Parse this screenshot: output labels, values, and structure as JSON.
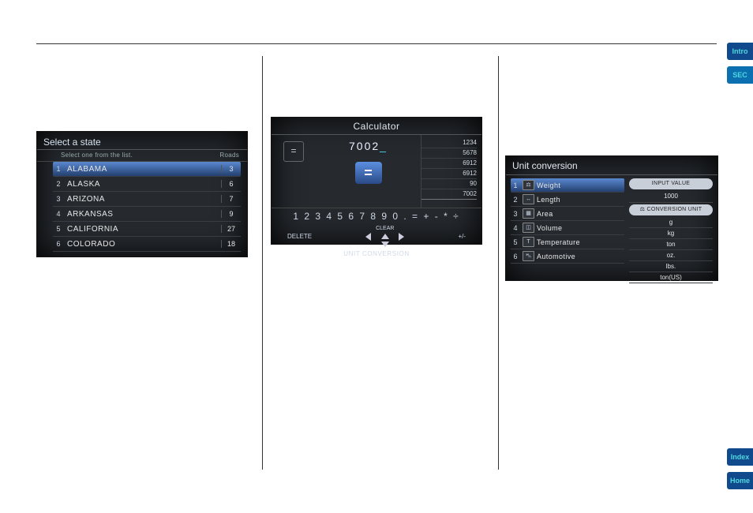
{
  "right_tabs": {
    "intro": "Intro",
    "sec": "SEC",
    "index": "Index",
    "home": "Home"
  },
  "select_state": {
    "title": "Select a state",
    "sublabel_left": "Select one from the list.",
    "sublabel_right": "Roads",
    "rows": [
      {
        "n": "1",
        "name": "ALABAMA",
        "count": "3"
      },
      {
        "n": "2",
        "name": "ALASKA",
        "count": "6"
      },
      {
        "n": "3",
        "name": "ARIZONA",
        "count": "7"
      },
      {
        "n": "4",
        "name": "ARKANSAS",
        "count": "9"
      },
      {
        "n": "5",
        "name": "CALIFORNIA",
        "count": "27"
      },
      {
        "n": "6",
        "name": "COLORADO",
        "count": "18"
      }
    ]
  },
  "calculator": {
    "title": "Calculator",
    "eq_small": "=",
    "display": "7002",
    "cursor": "_",
    "eq_big": "=",
    "history": [
      "1234",
      "5678",
      "6912",
      "6912",
      "90",
      "7002"
    ],
    "strip": "1 2 3 4 5 6 7 8 9 0 . = + - * ÷",
    "delete": "DELETE",
    "clear": "CLEAR",
    "plusminus": "+/-",
    "bottom": "UNIT CONVERSION"
  },
  "unit_conversion": {
    "title": "Unit conversion",
    "categories": [
      {
        "n": "1",
        "icon": "⚖",
        "name": "Weight"
      },
      {
        "n": "2",
        "icon": "↔",
        "name": "Length"
      },
      {
        "n": "3",
        "icon": "▦",
        "name": "Area"
      },
      {
        "n": "4",
        "icon": "◫",
        "name": "Volume"
      },
      {
        "n": "5",
        "icon": "T",
        "name": "Temperature"
      },
      {
        "n": "6",
        "icon": "⛍",
        "name": "Automotive"
      }
    ],
    "input_value_hdr": "INPUT VALUE",
    "input_value": "1000",
    "conversion_unit_hdr": "⚖ CONVERSION UNIT",
    "units": [
      "g",
      "kg",
      "ton",
      "oz.",
      "lbs.",
      "ton(US)"
    ]
  }
}
